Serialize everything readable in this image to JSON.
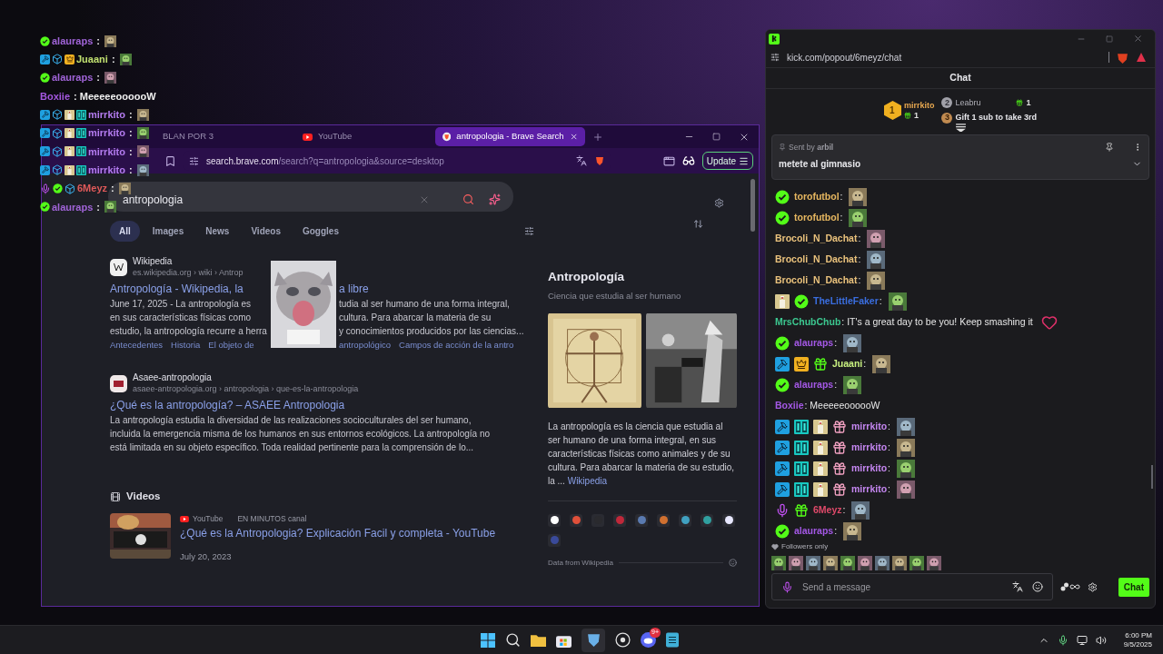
{
  "overlay_chat": [
    {
      "badges": [
        {
          "kind": "verified"
        }
      ],
      "name": "alauraps",
      "color": "#a064d8",
      "text": " :",
      "emote": {
        "kind": "picture"
      }
    },
    {
      "badges": [
        {
          "kind": "moderator"
        },
        {
          "kind": "cube"
        },
        {
          "kind": "crown"
        }
      ],
      "name": "Juaani",
      "color": "#c0e070",
      "text": " :",
      "emote": {
        "kind": "picture"
      }
    },
    {
      "badges": [
        {
          "kind": "verified"
        }
      ],
      "name": "alauraps",
      "color": "#a064d8",
      "text": " :",
      "emote": {
        "kind": "picture"
      }
    },
    {
      "name": "Boxiie",
      "color": "#a458e0",
      "text": " : MeeeeeoooooW"
    },
    {
      "badges": [
        {
          "kind": "moderator"
        },
        {
          "kind": "cube"
        },
        {
          "kind": "tux"
        },
        {
          "kind": "grid"
        }
      ],
      "name": "mirrkito",
      "color": "#b47cf0",
      "text": " :",
      "emote": {
        "kind": "picture"
      }
    },
    {
      "badges": [
        {
          "kind": "moderator"
        },
        {
          "kind": "cube"
        },
        {
          "kind": "tux"
        },
        {
          "kind": "grid"
        }
      ],
      "name": "mirrkito",
      "color": "#b47cf0",
      "text": " :",
      "emote": {
        "kind": "picture"
      }
    },
    {
      "badges": [
        {
          "kind": "moderator"
        },
        {
          "kind": "cube"
        },
        {
          "kind": "tux"
        },
        {
          "kind": "grid"
        }
      ],
      "name": "mirrkito",
      "color": "#b47cf0",
      "text": " :",
      "emote": {
        "kind": "picture"
      }
    },
    {
      "badges": [
        {
          "kind": "moderator"
        },
        {
          "kind": "cube"
        },
        {
          "kind": "tux"
        },
        {
          "kind": "grid"
        }
      ],
      "name": "mirrkito",
      "color": "#b47cf0",
      "text": " :",
      "emote": {
        "kind": "picture"
      }
    },
    {
      "badges": [
        {
          "kind": "mic"
        },
        {
          "kind": "verified"
        },
        {
          "kind": "cube"
        }
      ],
      "name": "6Meyz",
      "color": "#e05a5a",
      "text": " :",
      "emote": {
        "kind": "picture"
      }
    },
    {
      "badges": [
        {
          "kind": "verified"
        }
      ],
      "name": "alauraps",
      "color": "#a064d8",
      "text": " :",
      "emote": {
        "kind": "picture"
      }
    }
  ],
  "browser": {
    "tabs": [
      {
        "label": "BLAN POR 3",
        "selected": false
      },
      {
        "label": "YouTube",
        "selected": false,
        "kind": "youtube"
      },
      {
        "label": "antropologia - Brave Search",
        "selected": true,
        "kind": "brave"
      }
    ],
    "url_host": "search.brave.com",
    "url_path": "/search?q=antropologia&source=desktop",
    "update_button": "Update",
    "search": {
      "value": "antropologia"
    },
    "filters": [
      {
        "label": "All",
        "selected": true
      },
      {
        "label": "Images",
        "selected": false
      },
      {
        "label": "News",
        "selected": false
      },
      {
        "label": "Videos",
        "selected": false
      },
      {
        "label": "Goggles",
        "selected": false
      }
    ],
    "wiki_result": {
      "site": "Wikipedia",
      "url": "es.wikipedia.org › wiki › Antrop",
      "title": [
        "Antropología - Wikipedia, la",
        "a libre"
      ],
      "lines": [
        [
          "June 17, 2025 - La antropología es",
          "tudia al ser humano de una forma integral,"
        ],
        [
          "en sus características físicas como",
          "cultura. Para abarcar la materia de su"
        ],
        [
          "estudio, la antropología recurre a herra",
          "y conocimientos producidos por las ciencias..."
        ]
      ],
      "links": [
        [
          "Antecedentes",
          "Historia",
          "El objeto de"
        ],
        [
          "antropológico",
          "Campos de acción de la antro"
        ]
      ]
    },
    "result": {
      "site": "Asaee-antropologia",
      "url": "asaee-antropologia.org › antropologia › que-es-la-antropologia",
      "title": "¿Qué es la antropología? – ASAEE Antropologia",
      "snippet": "La antropología estudia la diversidad de las realizaciones socioculturales del ser humano, incluida la emergencia misma de los humanos en sus entornos ecológicos. La antropología no está limitada en su objeto específico. Toda realidad pertinente para la comprensión de lo..."
    },
    "videos": {
      "heading": "Videos",
      "items": [
        {
          "source": "YouTube",
          "channel": "EN MINUTOS canal",
          "title": "¿Qué es la Antropologia? Explicación Facil y completa - YouTube",
          "date": "July 20, 2023"
        }
      ]
    },
    "knowledge": {
      "title": "Antropología",
      "subtitle": "Ciencia que estudia al ser humano",
      "description": "La antropología es la ciencia que estudia al ser humano de una forma integral, en sus características físicas como animales y de su cultura. Para abarcar la materia de su estudio, la ...",
      "link": "Wikipedia",
      "sources": [
        {
          "color": "#ffffff"
        },
        {
          "color": "#e0503a"
        },
        {
          "color": "#2a2a2e"
        },
        {
          "color": "#c0283a"
        },
        {
          "color": "#5a7ab0"
        },
        {
          "color": "#d07030"
        },
        {
          "color": "#40a0c0"
        },
        {
          "color": "#30a0a0"
        },
        {
          "color": "#e8e8ff"
        },
        {
          "color": "#3a4a9a"
        }
      ],
      "footer": "Data from Wikipedia"
    }
  },
  "kick": {
    "url": "kick.com/popout/6meyz/chat",
    "title": "Chat",
    "leaderboard": [
      {
        "rank": "1",
        "name": "mirrkito",
        "count": "1"
      },
      {
        "rank": "2",
        "name": "Leabru",
        "count": "1"
      },
      {
        "rank": "3",
        "name": "Gift 1 sub to take 3rd"
      }
    ],
    "pinned": {
      "sender": "Sent by **arbil**",
      "message": "metete al gimnasio"
    },
    "messages": [
      {
        "badges": [
          {
            "kind": "verified"
          }
        ],
        "name": "torofutbol",
        "color": "#e8b860",
        "text": ":",
        "emote": {
          "kind": "picture"
        }
      },
      {
        "badges": [
          {
            "kind": "verified"
          }
        ],
        "name": "torofutbol",
        "color": "#e8b860",
        "text": ":",
        "emote": {
          "kind": "picture"
        }
      },
      {
        "name": "Brocoli_N_Dachat",
        "color": "#eac27c",
        "text": ":",
        "emote": {
          "kind": "picture"
        }
      },
      {
        "name": "Brocoli_N_Dachat",
        "color": "#eac27c",
        "text": ":",
        "emote": {
          "kind": "picture"
        }
      },
      {
        "name": "Brocoli_N_Dachat",
        "color": "#eac27c",
        "text": ":",
        "emote": {
          "kind": "picture"
        }
      },
      {
        "badges": [
          {
            "kind": "tux"
          },
          {
            "kind": "verified"
          }
        ],
        "name": "TheLittleFaker",
        "color": "#3a6ee0",
        "text": ":",
        "emote": {
          "kind": "picture"
        }
      },
      {
        "name": "MrsChubChub",
        "color": "#3cc890",
        "text": ": IT's a great day to be you! Keep smashing it",
        "heart": true
      },
      {
        "badges": [
          {
            "kind": "verified"
          }
        ],
        "name": "alauraps",
        "color": "#a458e6",
        "text": ":",
        "emote": {
          "kind": "picture"
        }
      },
      {
        "badges": [
          {
            "kind": "moderator"
          },
          {
            "kind": "crown"
          },
          {
            "kind": "gift"
          }
        ],
        "name": "Juaani",
        "color": "#c8f080",
        "text": ":",
        "emote": {
          "kind": "picture"
        }
      },
      {
        "badges": [
          {
            "kind": "verified"
          }
        ],
        "name": "alauraps",
        "color": "#a458e6",
        "text": ":",
        "emote": {
          "kind": "picture"
        }
      },
      {
        "name": "Boxiie",
        "color": "#a458e6",
        "text": ": MeeeeeoooooW"
      },
      {
        "badges": [
          {
            "kind": "moderator"
          },
          {
            "kind": "grid"
          },
          {
            "kind": "tux"
          },
          {
            "kind": "gifter"
          }
        ],
        "name": "mirrkito",
        "color": "#c486f0",
        "text": ":",
        "emote": {
          "kind": "picture"
        }
      },
      {
        "badges": [
          {
            "kind": "moderator"
          },
          {
            "kind": "grid"
          },
          {
            "kind": "tux"
          },
          {
            "kind": "gifter"
          }
        ],
        "name": "mirrkito",
        "color": "#c486f0",
        "text": ":",
        "emote": {
          "kind": "picture"
        }
      },
      {
        "badges": [
          {
            "kind": "moderator"
          },
          {
            "kind": "grid"
          },
          {
            "kind": "tux"
          },
          {
            "kind": "gifter"
          }
        ],
        "name": "mirrkito",
        "color": "#c486f0",
        "text": ":",
        "emote": {
          "kind": "picture"
        }
      },
      {
        "badges": [
          {
            "kind": "moderator"
          },
          {
            "kind": "grid"
          },
          {
            "kind": "tux"
          },
          {
            "kind": "gifter"
          }
        ],
        "name": "mirrkito",
        "color": "#c486f0",
        "text": ":",
        "emote": {
          "kind": "picture"
        }
      },
      {
        "badges": [
          {
            "kind": "mic"
          },
          {
            "kind": "gift"
          }
        ],
        "name": "6Meyz",
        "color": "#e04a6a",
        "text": ":",
        "emote": {
          "kind": "picture"
        }
      },
      {
        "badges": [
          {
            "kind": "verified"
          }
        ],
        "name": "alauraps",
        "color": "#a458e6",
        "text": ":",
        "emote": {
          "kind": "picture"
        }
      }
    ],
    "mode": "Followers only",
    "input": {
      "placeholder": "Send a message"
    },
    "send_button": "Chat"
  },
  "taskbar": {
    "time": "6:00 PM",
    "date": "9/5/2025",
    "discord_badge": "9+"
  }
}
